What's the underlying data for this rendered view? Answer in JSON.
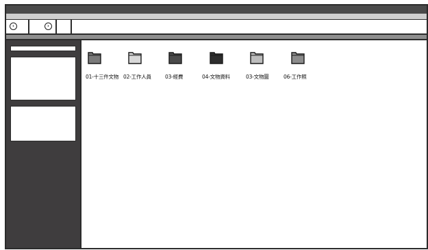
{
  "nav": {
    "back_icon": "arrow-left-circle-icon",
    "forward_icon": "arrow-right-circle-icon"
  },
  "folders": [
    {
      "label": "01-十三件文物",
      "shade": "#7a7a7a"
    },
    {
      "label": "02-工作人員",
      "shade": "#d8d8d8"
    },
    {
      "label": "03-經費",
      "shade": "#4a4a4a"
    },
    {
      "label": "04-文物資料",
      "shade": "#2e2e2e"
    },
    {
      "label": "03-文物圖",
      "shade": "#bdbdbd"
    },
    {
      "label": "06-工作照",
      "shade": "#8c8c8c"
    }
  ]
}
